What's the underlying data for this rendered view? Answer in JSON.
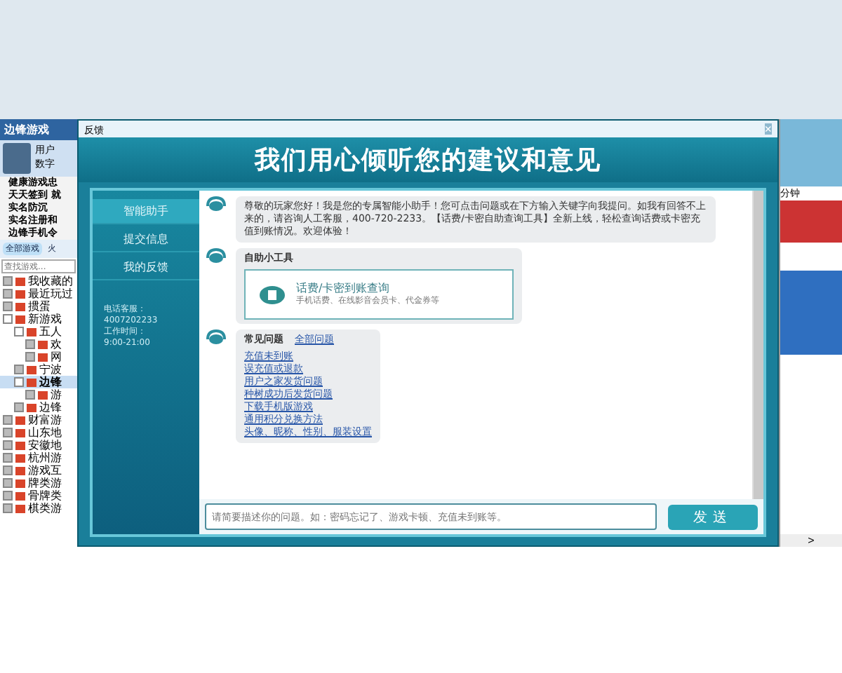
{
  "background_app": {
    "title": "边锋游戏",
    "user_lines": [
      "用户",
      "数字"
    ],
    "notices": [
      "健康游戏忠",
      "天天签到 就",
      "实名防沉",
      "实名注册和",
      "边锋手机令"
    ],
    "tabs": [
      {
        "label": "全部游戏",
        "selected": true
      },
      {
        "label": "火",
        "selected": false
      }
    ],
    "search": {
      "placeholder": "查找游戏..."
    },
    "tree": [
      {
        "label": "我收藏的",
        "expanded": false
      },
      {
        "label": "最近玩过",
        "expanded": false
      },
      {
        "label": "掼蛋",
        "expanded": false
      },
      {
        "label": "新游戏",
        "expanded": true,
        "children": [
          {
            "label": "五人",
            "expanded": true,
            "children": [
              {
                "label": "欢",
                "expanded": false
              },
              {
                "label": "网",
                "expanded": false
              }
            ]
          },
          {
            "label": "宁波",
            "expanded": false
          },
          {
            "label": "边锋",
            "expanded": true,
            "selected": true,
            "children": [
              {
                "label": "游",
                "expanded": false
              }
            ]
          },
          {
            "label": "边锋",
            "expanded": false
          }
        ]
      },
      {
        "label": "财富游",
        "expanded": false
      },
      {
        "label": "山东地",
        "expanded": false
      },
      {
        "label": "安徽地",
        "expanded": false
      },
      {
        "label": "杭州游",
        "expanded": false
      },
      {
        "label": "游戏互",
        "expanded": false
      },
      {
        "label": "牌类游",
        "expanded": false
      },
      {
        "label": "骨牌类",
        "expanded": false
      },
      {
        "label": "棋类游",
        "expanded": false
      }
    ],
    "right_label": "分钟",
    "right_arrow": ">"
  },
  "dialog": {
    "title": "反馈",
    "close": "×",
    "banner": "我们用心倾听您的建议和意见",
    "nav": [
      {
        "label": "智能助手",
        "selected": true
      },
      {
        "label": "提交信息",
        "selected": false
      },
      {
        "label": "我的反馈",
        "selected": false
      }
    ],
    "contact": [
      "电话客服：",
      "4007202233",
      "工作时间：",
      "9:00-21:00"
    ],
    "messages": [
      {
        "kind": "text",
        "text": "尊敬的玩家您好！我是您的专属智能小助手！您可点击问题或在下方输入关键字向我提问。如我有回答不上来的，请咨询人工客服，400-720-2233。【话费/卡密自助查询工具】全新上线，轻松查询话费或卡密充值到账情况。欢迎体验！"
      },
      {
        "kind": "tool",
        "title": "自助小工具",
        "tool_name": "话费/卡密到账查询",
        "tool_desc": "手机话费、在线影音会员卡、代金券等"
      },
      {
        "kind": "faq",
        "title": "常见问题",
        "all_link": "全部问题",
        "links": [
          "充值未到账",
          "误充值或退款",
          "用户之家发货问题",
          "种树成功后发货问题",
          "下载手机版游戏",
          "通用积分兑换方法",
          "头像、昵称、性别、服装设置"
        ]
      }
    ],
    "input": {
      "placeholder": "请简要描述你的问题。如：密码忘记了、游戏卡顿、充值未到账等。"
    },
    "send": "发送"
  }
}
